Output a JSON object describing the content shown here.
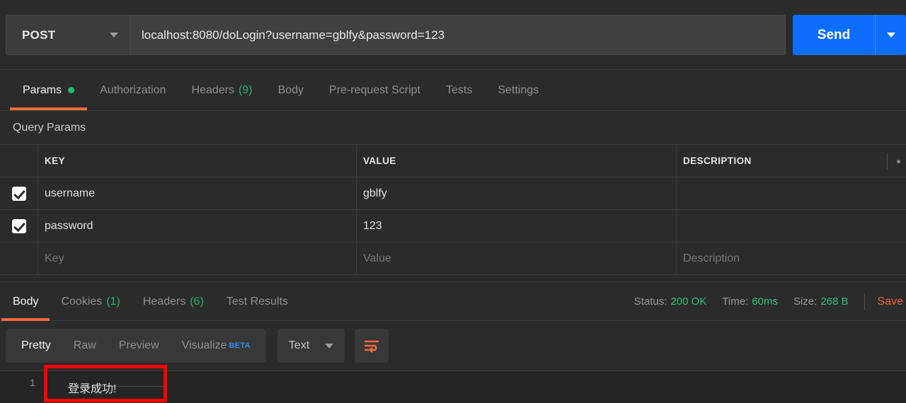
{
  "request_bar": {
    "method": "POST",
    "method_caret": "chevron-down-icon",
    "url": "localhost:8080/doLogin?username=gblfy&password=123",
    "send_label": "Send",
    "send_caret": "chevron-down-icon"
  },
  "request_tabs": [
    {
      "label": "Params",
      "active": true,
      "dot": true
    },
    {
      "label": "Authorization",
      "active": false
    },
    {
      "label": "Headers",
      "active": false,
      "count": "(9)"
    },
    {
      "label": "Body",
      "active": false
    },
    {
      "label": "Pre-request Script",
      "active": false
    },
    {
      "label": "Tests",
      "active": false
    },
    {
      "label": "Settings",
      "active": false
    }
  ],
  "query_params": {
    "section_title": "Query Params",
    "columns": [
      "KEY",
      "VALUE",
      "DESCRIPTION"
    ],
    "rows": [
      {
        "checked": true,
        "key": "username",
        "value": "gblfy",
        "description": ""
      },
      {
        "checked": true,
        "key": "password",
        "value": "123",
        "description": ""
      }
    ],
    "placeholder_row": {
      "key": "Key",
      "value": "Value",
      "description": "Description"
    }
  },
  "response_tabs": [
    {
      "label": "Body",
      "active": true
    },
    {
      "label": "Cookies",
      "active": false,
      "count": "(1)"
    },
    {
      "label": "Headers",
      "active": false,
      "count": "(6)"
    },
    {
      "label": "Test Results",
      "active": false
    }
  ],
  "response_meta": {
    "status_label": "Status:",
    "status_value": "200 OK",
    "time_label": "Time:",
    "time_value": "60ms",
    "size_label": "Size:",
    "size_value": "268 B",
    "save_label": "Save"
  },
  "body_toolbar": {
    "formats": [
      {
        "label": "Pretty",
        "active": true
      },
      {
        "label": "Raw",
        "active": false
      },
      {
        "label": "Preview",
        "active": false
      },
      {
        "label": "Visualize",
        "active": false,
        "badge": "BETA"
      }
    ],
    "type_select": "Text",
    "type_caret": "chevron-down-icon",
    "wrap_icon": "wrap-text-icon"
  },
  "response_body": {
    "line_number": "1",
    "content": "登录成功!"
  },
  "colors": {
    "accent_orange": "#f26b3a",
    "send_blue": "#0d6efd",
    "status_green": "#2ec27e",
    "annotation_red": "#ff0000",
    "beta_blue": "#2f8fee"
  }
}
